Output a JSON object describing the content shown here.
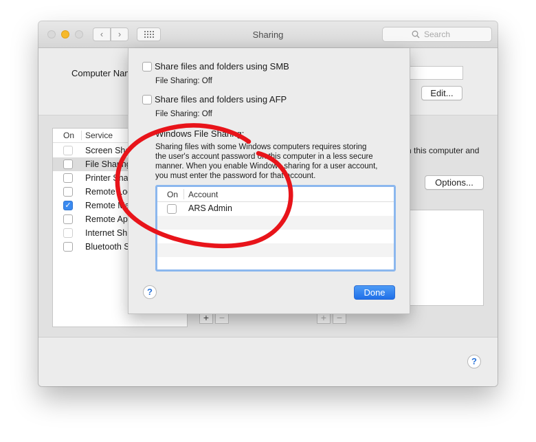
{
  "window": {
    "title": "Sharing",
    "search_placeholder": "Search",
    "computer_name_label": "Computer Nam",
    "edit_button": "Edit...",
    "options_button": "Options...",
    "description_fragment": "n this computer and",
    "services": {
      "header_on": "On",
      "header_service": "Service",
      "items": [
        {
          "label": "Screen Sha",
          "checked": false,
          "dim": true
        },
        {
          "label": "File Sharing",
          "checked": false,
          "dim": false
        },
        {
          "label": "Printer Sha",
          "checked": false,
          "dim": false
        },
        {
          "label": "Remote Log",
          "checked": false,
          "dim": false
        },
        {
          "label": "Remote Ma",
          "checked": true,
          "dim": false
        },
        {
          "label": "Remote Ap",
          "checked": false,
          "dim": false
        },
        {
          "label": "Internet Sh",
          "checked": false,
          "dim": true
        },
        {
          "label": "Bluetooth S",
          "checked": false,
          "dim": false
        }
      ]
    },
    "add_symbol": "+",
    "remove_symbol": "−",
    "help_symbol": "?"
  },
  "sheet": {
    "smb_label": "Share files and folders using SMB",
    "smb_status": "File Sharing: Off",
    "afp_label": "Share files and folders using AFP",
    "afp_status": "File Sharing: Off",
    "windows_heading": "Windows File Sharing:",
    "windows_description": [
      "Sharing files with some Windows computers requires storing",
      "the user's account password on this computer in a less secure",
      "manner.  When you enable Windows sharing for a user account,",
      "you must enter the password for that account."
    ],
    "table": {
      "header_on": "On",
      "header_account": "Account",
      "rows": [
        {
          "account": "ARS Admin",
          "checked": false
        }
      ]
    },
    "done_button": "Done",
    "help_symbol": "?"
  },
  "colors": {
    "accent": "#2a74d9",
    "annotation": "#e8141a",
    "close": "#d8d8d8",
    "minimize": "#f5b82a",
    "zoom": "#d8d8d8"
  }
}
